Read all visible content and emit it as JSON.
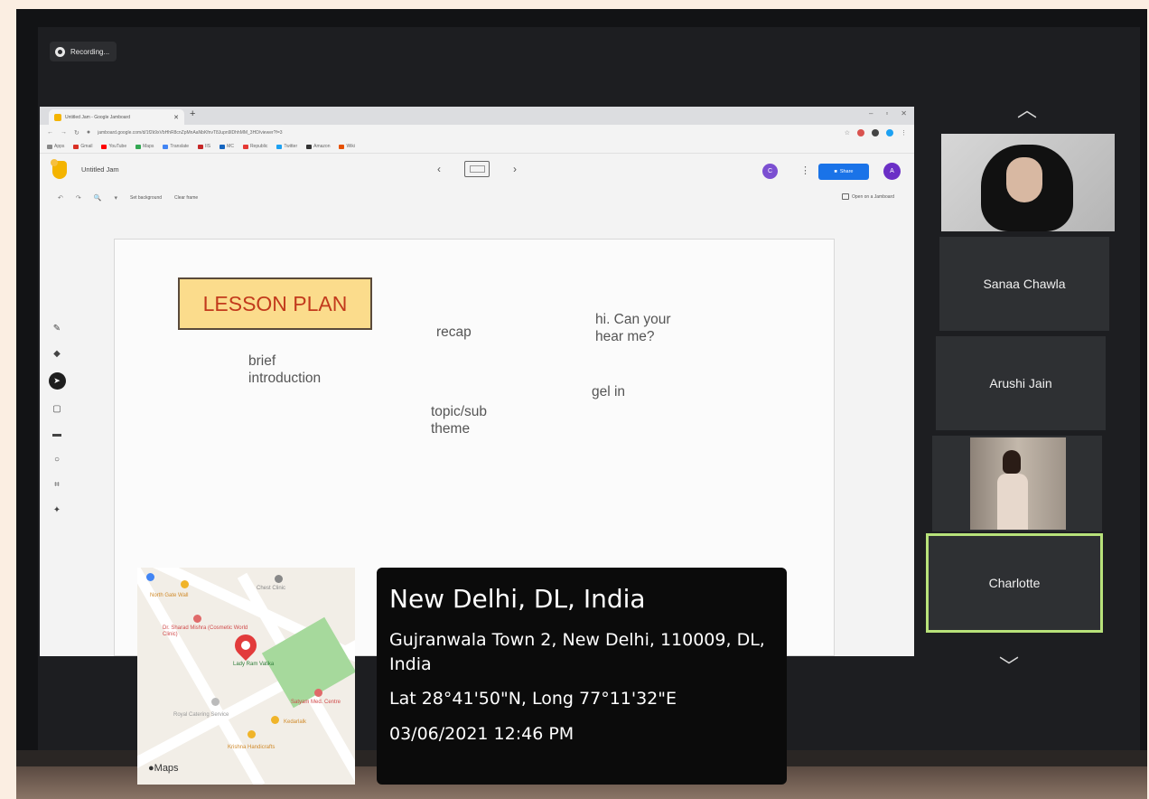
{
  "recording": {
    "label": "Recording..."
  },
  "browser": {
    "tab_title": "Untitled Jam - Google Jamboard",
    "url": "jamboard.google.com/d/1f2k9xVbHhR8cnZpMnAaNbKfnvT8Jupn9lDhhMM_3HD/viewer?f=3",
    "bookmarks": [
      "Apps",
      "Gmail",
      "YouTube",
      "Maps",
      "Translate",
      "IIS",
      "MC",
      "Republic",
      "Twitter",
      "Amazon",
      "Wiki"
    ]
  },
  "jamboard": {
    "doc_title": "Untitled Jam",
    "frame_counter": "3/3",
    "collaborator_initial": "C",
    "share_label": "Share",
    "account_initial": "A",
    "set_background": "Set background",
    "clear_frame": "Clear frame",
    "open_on_jamboard": "Open on a Jamboard",
    "canvas": {
      "title": "LESSON PLAN",
      "notes": [
        "brief\nintroduction",
        "recap",
        "topic/sub\ntheme",
        "hi. Can your\nhear me?",
        "gel in"
      ]
    }
  },
  "participants": [
    {
      "name": "Sanaa Chawla"
    },
    {
      "name": "Arushi Jain"
    },
    {
      "name": "Charlotte"
    }
  ],
  "map": {
    "brand": "Maps",
    "pois": [
      "North Gate Wall",
      "Chest Clinic",
      "Dr. Sharad Mishra (Cosmetic World Clinic)",
      "Lady Ram Vatika",
      "Satyam Med. Centre",
      "Royal Catering Service",
      "Kedarlalk",
      "Krishna Handicrafts"
    ]
  },
  "location": {
    "city": "New Delhi, DL, India",
    "address": "Gujranwala Town 2, New Delhi, 110009, DL, India",
    "coords": "Lat 28°41'50\"N, Long 77°11'32\"E",
    "datetime": "03/06/2021 12:46 PM"
  }
}
